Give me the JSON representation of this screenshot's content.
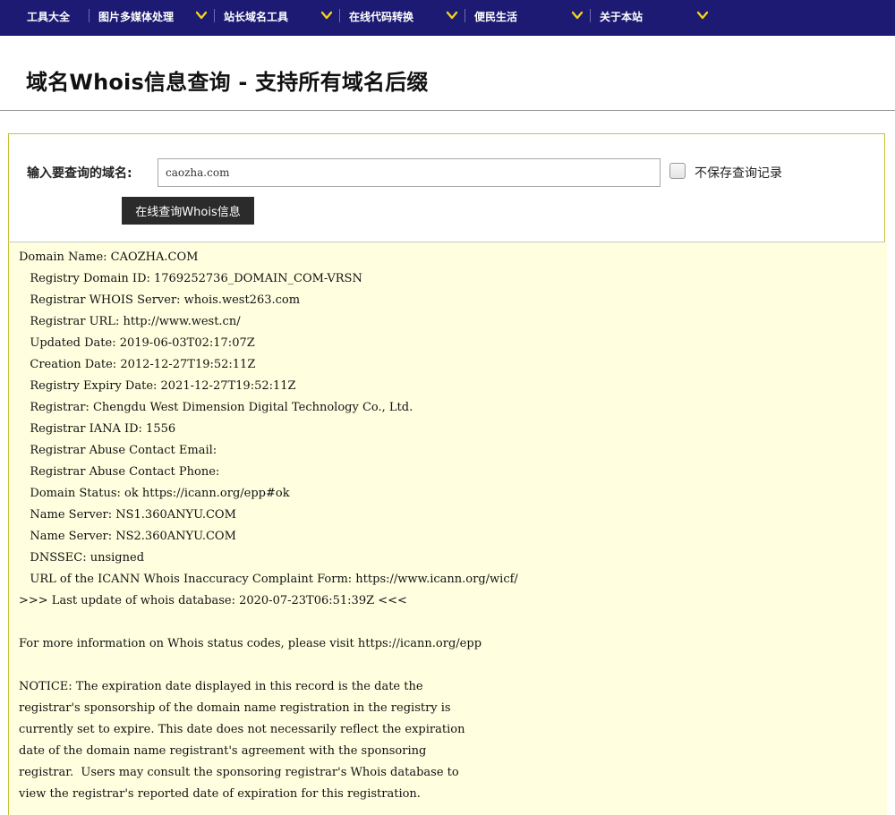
{
  "nav": {
    "items": [
      {
        "label": "工具大全"
      },
      {
        "label": "图片多媒体处理"
      },
      {
        "label": "站长域名工具"
      },
      {
        "label": "在线代码转换"
      },
      {
        "label": "便民生活"
      },
      {
        "label": "关于本站"
      }
    ]
  },
  "page": {
    "title": "域名Whois信息查询 - 支持所有域名后缀"
  },
  "form": {
    "domain_label": "输入要查询的域名:",
    "domain_value": "caozha.com",
    "no_save_label": "不保存查询记录",
    "no_save_checked": false,
    "submit_label": "在线查询Whois信息"
  },
  "result": {
    "lines": [
      "Domain Name: CAOZHA.COM",
      "   Registry Domain ID: 1769252736_DOMAIN_COM-VRSN",
      "   Registrar WHOIS Server: whois.west263.com",
      "   Registrar URL: http://www.west.cn/",
      "   Updated Date: 2019-06-03T02:17:07Z",
      "   Creation Date: 2012-12-27T19:52:11Z",
      "   Registry Expiry Date: 2021-12-27T19:52:11Z",
      "   Registrar: Chengdu West Dimension Digital Technology Co., Ltd.",
      "   Registrar IANA ID: 1556",
      "   Registrar Abuse Contact Email:",
      "   Registrar Abuse Contact Phone:",
      "   Domain Status: ok https://icann.org/epp#ok",
      "   Name Server: NS1.360ANYU.COM",
      "   Name Server: NS2.360ANYU.COM",
      "   DNSSEC: unsigned",
      "   URL of the ICANN Whois Inaccuracy Complaint Form: https://www.icann.org/wicf/",
      ">>> Last update of whois database: 2020-07-23T06:51:39Z <<<",
      "",
      "For more information on Whois status codes, please visit https://icann.org/epp",
      "",
      "NOTICE: The expiration date displayed in this record is the date the",
      "registrar's sponsorship of the domain name registration in the registry is",
      "currently set to expire. This date does not necessarily reflect the expiration",
      "date of the domain name registrant's agreement with the sponsoring",
      "registrar.  Users may consult the sponsoring registrar's Whois database to",
      "view the registrar's reported date of expiration for this registration."
    ]
  },
  "colors": {
    "nav_bg": "#1c1a72",
    "caret": "#f2d21b",
    "result_bg": "#ffffe0",
    "panel_border": "#c8c23a",
    "button_bg": "#2b2b2b"
  }
}
